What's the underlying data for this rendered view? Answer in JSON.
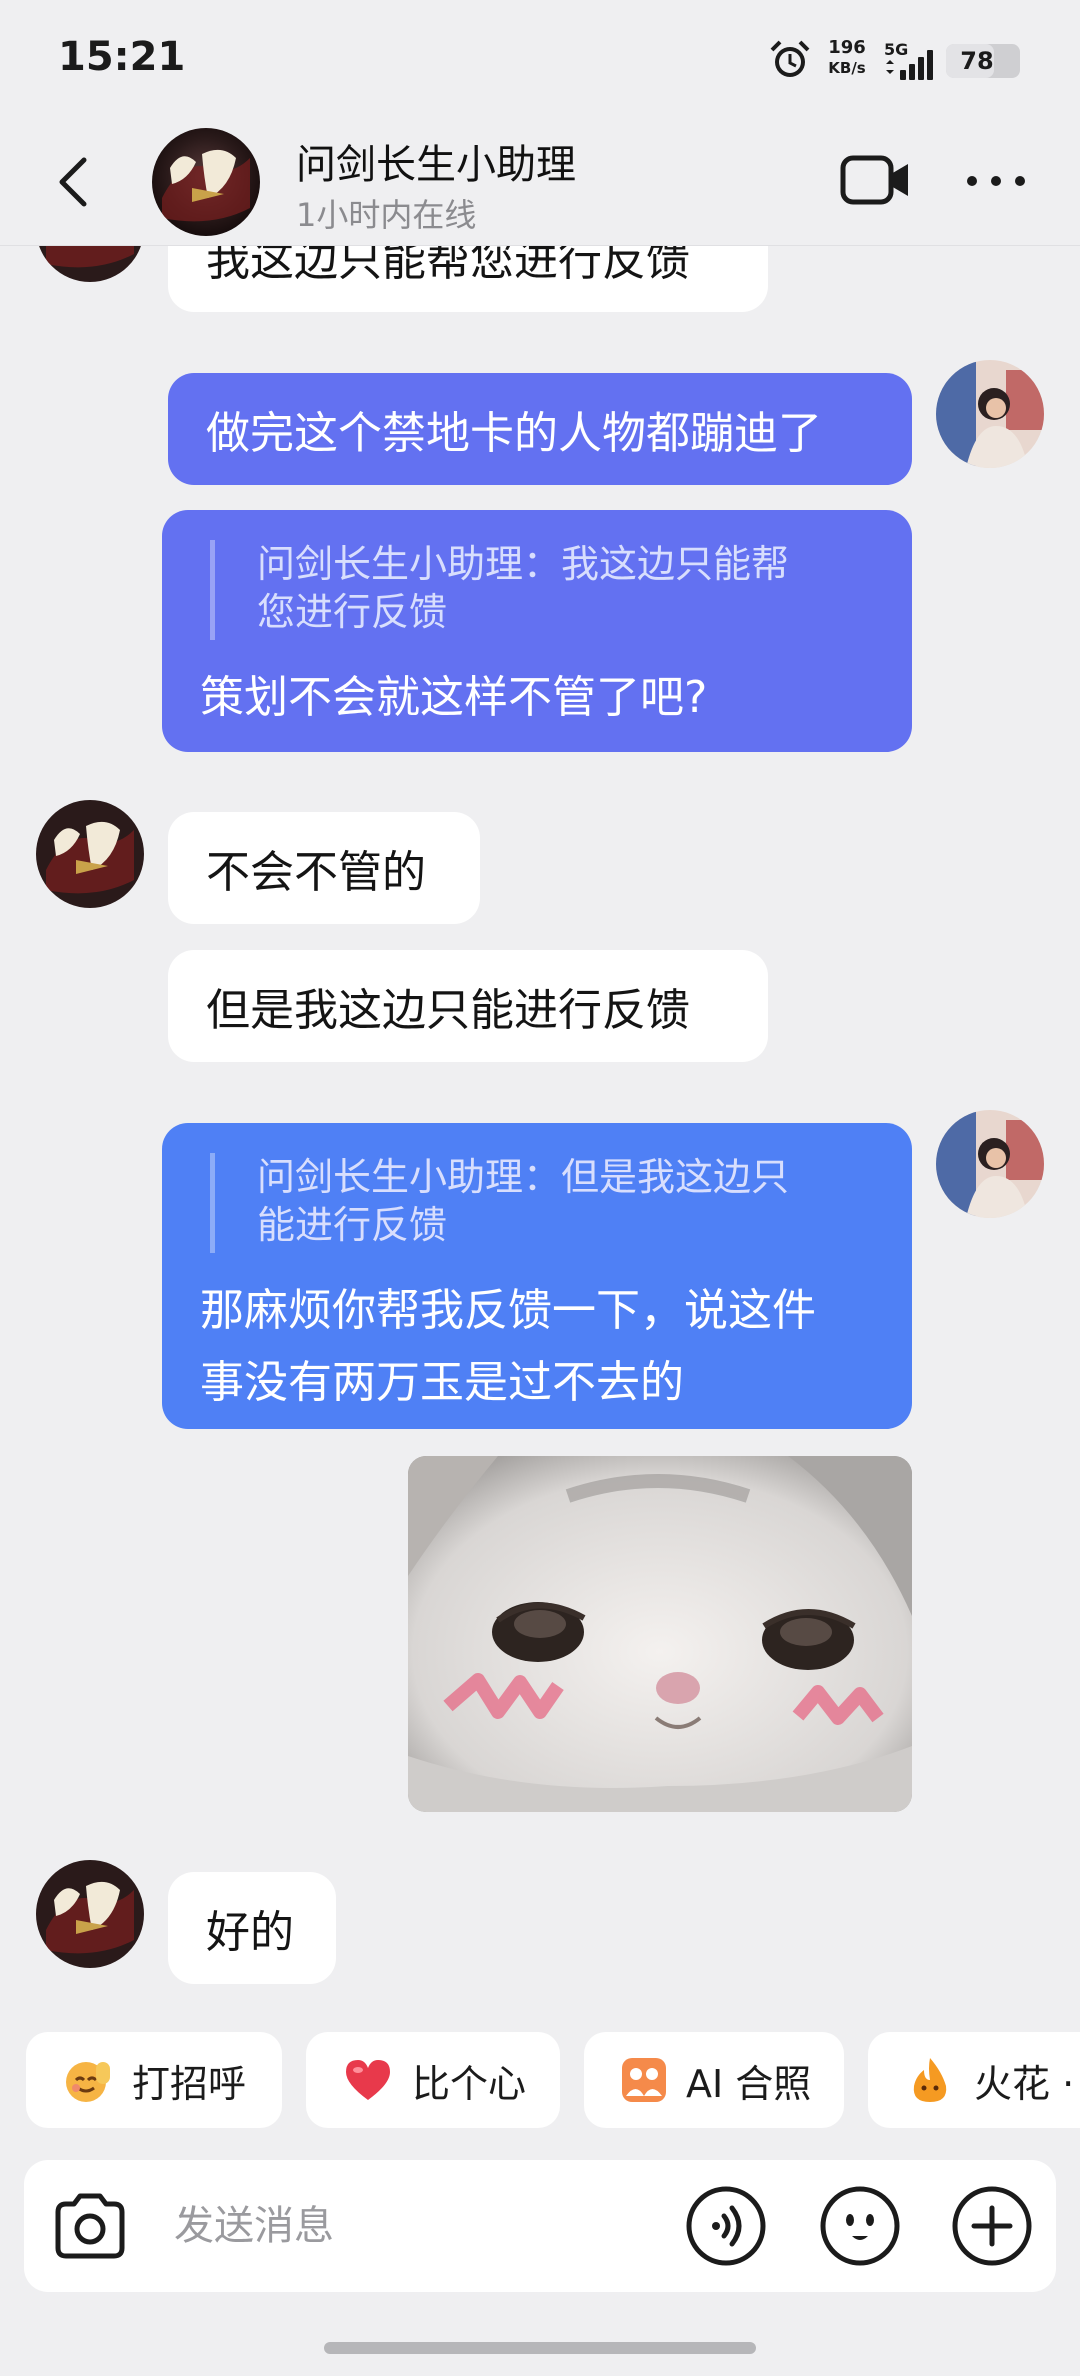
{
  "status_bar": {
    "time": "15:21",
    "net_speed_value": "196",
    "net_speed_unit": "KB/s",
    "network": "5G",
    "battery": "78",
    "battery_level": 0.78
  },
  "header": {
    "contact_name": "问剑长生小助理",
    "status": "1小时内在线"
  },
  "messages": [
    {
      "side": "left",
      "text": "我这边只能帮您进行反馈"
    },
    {
      "side": "right",
      "text": "做完这个禁地卡的人物都蹦迪了"
    },
    {
      "side": "right",
      "quote": "问剑长生小助理：我这边只能帮您进行反馈",
      "quote_line1": "问剑长生小助理：我这边只能帮",
      "quote_line2": "您进行反馈",
      "text": "策划不会就这样不管了吧?"
    },
    {
      "side": "left",
      "text": "不会不管的"
    },
    {
      "side": "left",
      "text": "但是我这边只能进行反馈"
    },
    {
      "side": "right",
      "quote_line1": "问剑长生小助理：但是我这边只",
      "quote_line2": "能进行反馈",
      "text_line1": "那麻烦你帮我反馈一下，说这件",
      "text_line2": "事没有两万玉是过不去的"
    },
    {
      "side": "right",
      "type": "image",
      "image": "crying-cat-sticker"
    },
    {
      "side": "left",
      "text": "好的"
    }
  ],
  "quick_replies": [
    {
      "label": "打招呼",
      "icon": "wave-emoji-icon"
    },
    {
      "label": "比个心",
      "icon": "heart-icon"
    },
    {
      "label": "AI 合照",
      "icon": "ai-photo-icon"
    },
    {
      "label": "火花 ·",
      "icon": "fire-icon"
    }
  ],
  "input": {
    "placeholder": "发送消息"
  },
  "colors": {
    "bubble_purple": "#6371f1",
    "bubble_blue": "#4f80f5",
    "background": "#efeff1"
  }
}
